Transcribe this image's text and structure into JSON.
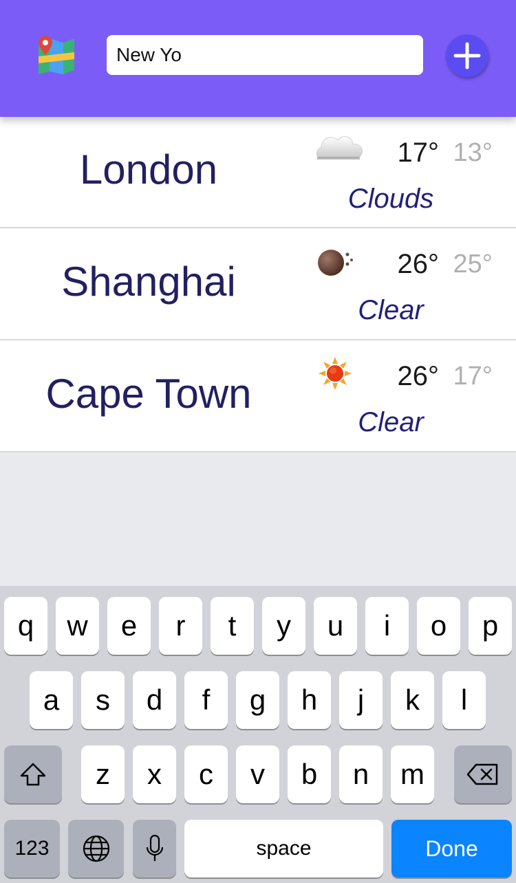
{
  "header": {
    "search_value": "New Yo",
    "map_icon": "map-icon",
    "add_icon": "plus-icon",
    "accent": "#7b5cf6"
  },
  "cities": [
    {
      "name": "London",
      "temp": "17°",
      "temp_min": "13°",
      "condition": "Clouds",
      "icon": "cloud-icon"
    },
    {
      "name": "Shanghai",
      "temp": "26°",
      "temp_min": "25°",
      "condition": "Clear",
      "icon": "moon-icon"
    },
    {
      "name": "Cape Town",
      "temp": "26°",
      "temp_min": "17°",
      "condition": "Clear",
      "icon": "sun-icon"
    }
  ],
  "keyboard": {
    "row1": [
      "q",
      "w",
      "e",
      "r",
      "t",
      "y",
      "u",
      "i",
      "o",
      "p"
    ],
    "row2": [
      "a",
      "s",
      "d",
      "f",
      "g",
      "h",
      "j",
      "k",
      "l"
    ],
    "row3": [
      "z",
      "x",
      "c",
      "v",
      "b",
      "n",
      "m"
    ],
    "numbers_label": "123",
    "space_label": "space",
    "done_label": "Done"
  }
}
